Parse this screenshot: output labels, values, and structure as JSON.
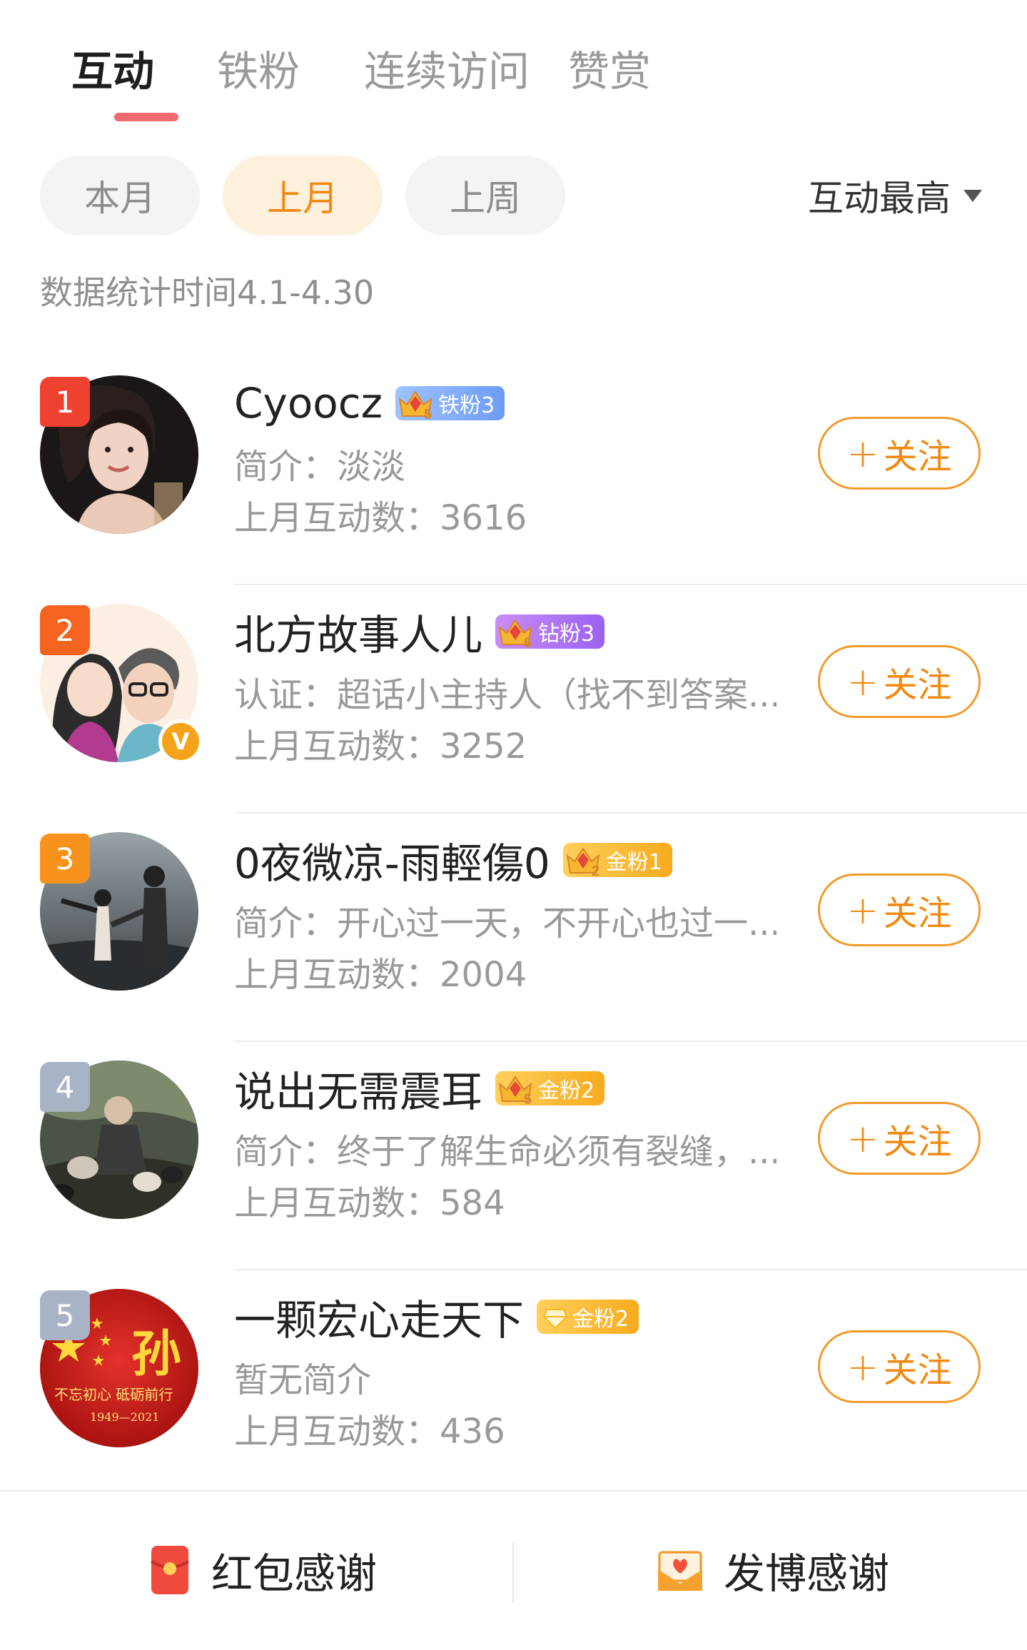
{
  "tabs": [
    {
      "label": "互动"
    },
    {
      "label": "铁粉"
    },
    {
      "label": "连续访问"
    },
    {
      "label": "赞赏"
    }
  ],
  "filters": [
    {
      "label": "本月"
    },
    {
      "label": "上月"
    },
    {
      "label": "上周"
    }
  ],
  "sort_label": "互动最高",
  "date_range": "数据统计时间4.1-4.30",
  "follow_label": "关注",
  "users": [
    {
      "rank": "1",
      "name": "Cyoocz",
      "badge_level": "5",
      "badge": "铁粉3",
      "desc": "简介：淡淡",
      "count": "上月互动数：3616"
    },
    {
      "rank": "2",
      "name": "北方故事人儿",
      "badge_level": "6",
      "badge": "钻粉3",
      "desc": "认证：超话小主持人（找不到答案...",
      "count": "上月互动数：3252",
      "verified": "V"
    },
    {
      "rank": "3",
      "name": "0夜微凉-雨輕傷0",
      "badge_level": "2",
      "badge": "金粉1",
      "desc": "简介：开心过一天，不开心也过一...",
      "count": "上月互动数：2004"
    },
    {
      "rank": "4",
      "name": "说出无需震耳",
      "badge_level": "5",
      "badge": "金粉2",
      "desc": "简介：终于了解生命必须有裂缝，...",
      "count": "上月互动数：584"
    },
    {
      "rank": "5",
      "name": "一颗宏心走天下",
      "badge": "金粉2",
      "desc": "暂无简介",
      "count": "上月互动数：436",
      "avatar_char": "孙",
      "avatar_text": "不忘初心  砥砺前行",
      "avatar_years": "1949—2021"
    }
  ],
  "bottom": {
    "left_label": "红包感谢",
    "right_label": "发博感谢"
  }
}
